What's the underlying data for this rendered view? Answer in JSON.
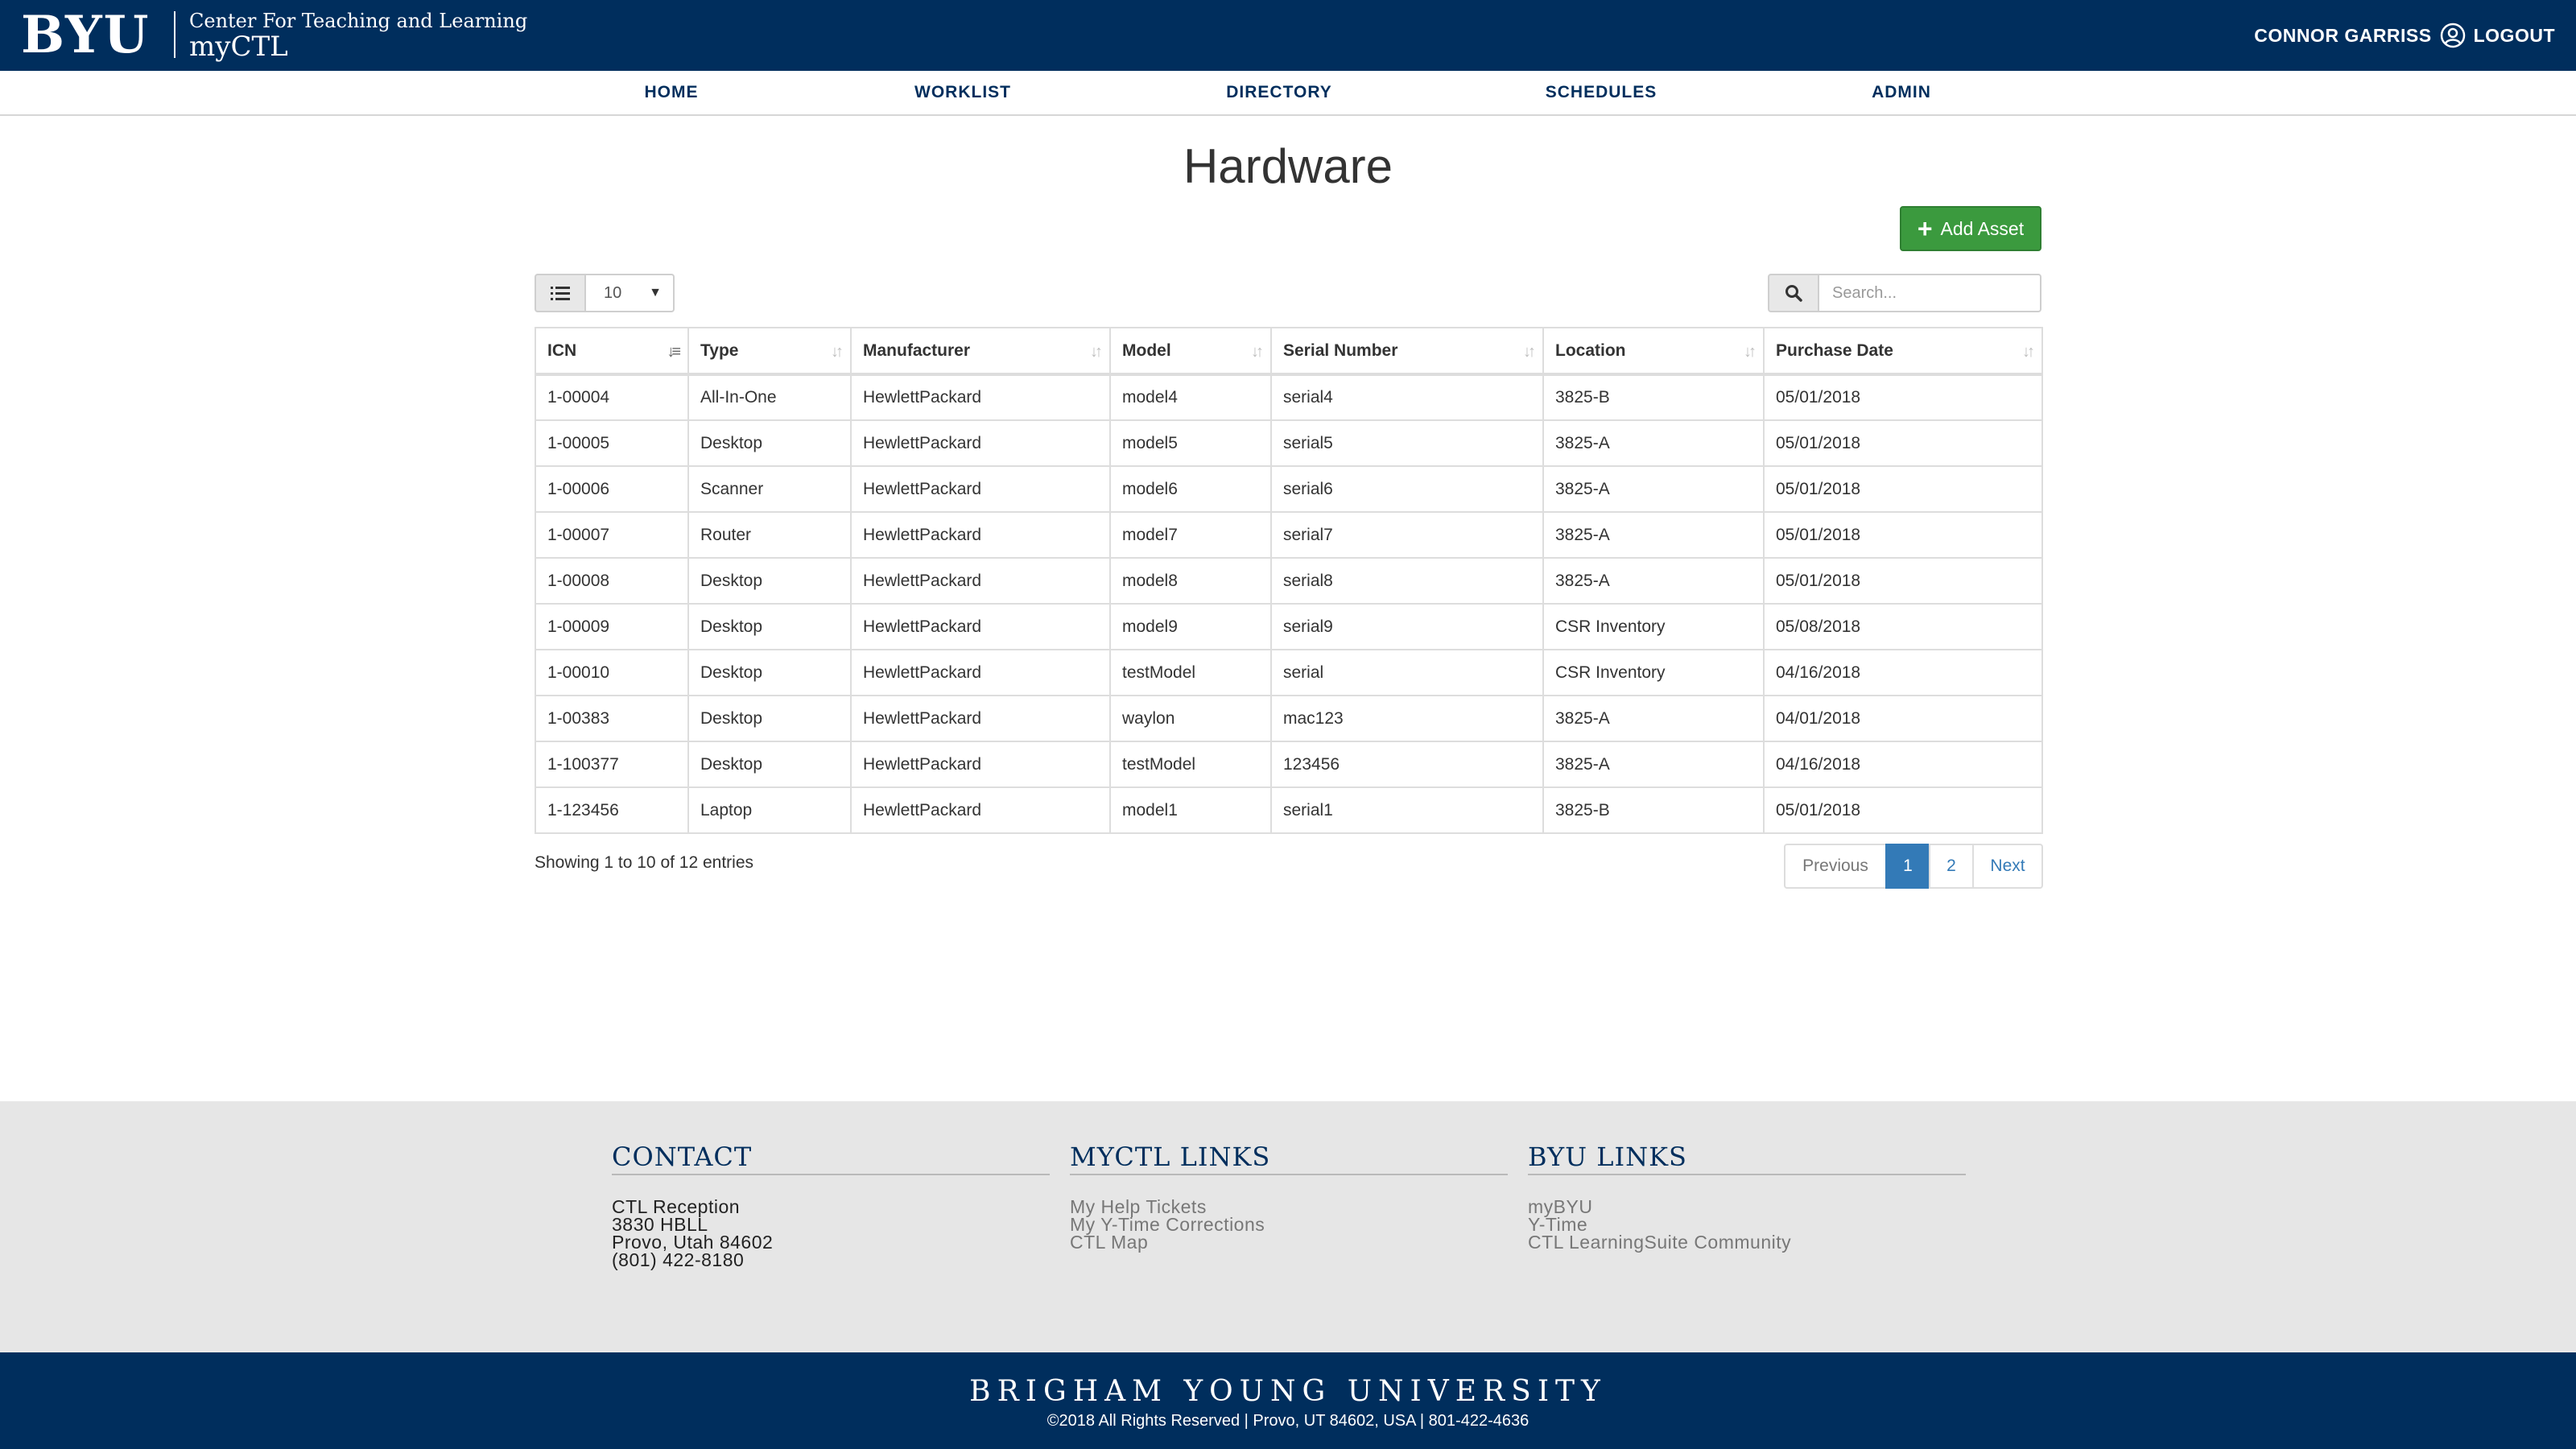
{
  "header": {
    "logo": "BYU",
    "subtitle": "Center For Teaching and Learning",
    "site_name": "myCTL",
    "user_name": "CONNOR GARRISS",
    "logout_label": "LOGOUT",
    "brand_color": "#002e5d"
  },
  "nav": {
    "items": [
      {
        "label": "HOME"
      },
      {
        "label": "WORKLIST"
      },
      {
        "label": "DIRECTORY"
      },
      {
        "label": "SCHEDULES"
      },
      {
        "label": "ADMIN"
      }
    ]
  },
  "main": {
    "title": "Hardware",
    "add_button": "Add Asset",
    "add_button_color": "#3b9a3e",
    "page_length": "10",
    "search_placeholder": "Search...",
    "columns": [
      "ICN",
      "Type",
      "Manufacturer",
      "Model",
      "Serial Number",
      "Location",
      "Purchase Date"
    ],
    "sorted_column": "ICN",
    "rows": [
      [
        "1-00004",
        "All-In-One",
        "HewlettPackard",
        "model4",
        "serial4",
        "3825-B",
        "05/01/2018"
      ],
      [
        "1-00005",
        "Desktop",
        "HewlettPackard",
        "model5",
        "serial5",
        "3825-A",
        "05/01/2018"
      ],
      [
        "1-00006",
        "Scanner",
        "HewlettPackard",
        "model6",
        "serial6",
        "3825-A",
        "05/01/2018"
      ],
      [
        "1-00007",
        "Router",
        "HewlettPackard",
        "model7",
        "serial7",
        "3825-A",
        "05/01/2018"
      ],
      [
        "1-00008",
        "Desktop",
        "HewlettPackard",
        "model8",
        "serial8",
        "3825-A",
        "05/01/2018"
      ],
      [
        "1-00009",
        "Desktop",
        "HewlettPackard",
        "model9",
        "serial9",
        "CSR Inventory",
        "05/08/2018"
      ],
      [
        "1-00010",
        "Desktop",
        "HewlettPackard",
        "testModel",
        "serial",
        "CSR Inventory",
        "04/16/2018"
      ],
      [
        "1-00383",
        "Desktop",
        "HewlettPackard",
        "waylon",
        "mac123",
        "3825-A",
        "04/01/2018"
      ],
      [
        "1-100377",
        "Desktop",
        "HewlettPackard",
        "testModel",
        "123456",
        "3825-A",
        "04/16/2018"
      ],
      [
        "1-123456",
        "Laptop",
        "HewlettPackard",
        "model1",
        "serial1",
        "3825-B",
        "05/01/2018"
      ]
    ],
    "info": "Showing 1 to 10 of 12 entries",
    "pagination": {
      "previous": "Previous",
      "pages": [
        "1",
        "2"
      ],
      "active_page": "1",
      "next": "Next"
    }
  },
  "footer": {
    "contact": {
      "heading": "CONTACT",
      "lines": [
        "CTL Reception",
        "3830 HBLL",
        "Provo, Utah 84602",
        "(801) 422-8180"
      ]
    },
    "myctl_links": {
      "heading": "MYCTL LINKS",
      "links": [
        "My Help Tickets",
        "My Y-Time Corrections",
        "CTL Map"
      ]
    },
    "byu_links": {
      "heading": "BYU LINKS",
      "links": [
        "myBYU",
        "Y-Time",
        "CTL LearningSuite Community"
      ]
    },
    "university": "BRIGHAM YOUNG UNIVERSITY",
    "copyright": "©2018 All Rights Reserved | Provo, UT 84602, USA | 801-422-4636"
  }
}
